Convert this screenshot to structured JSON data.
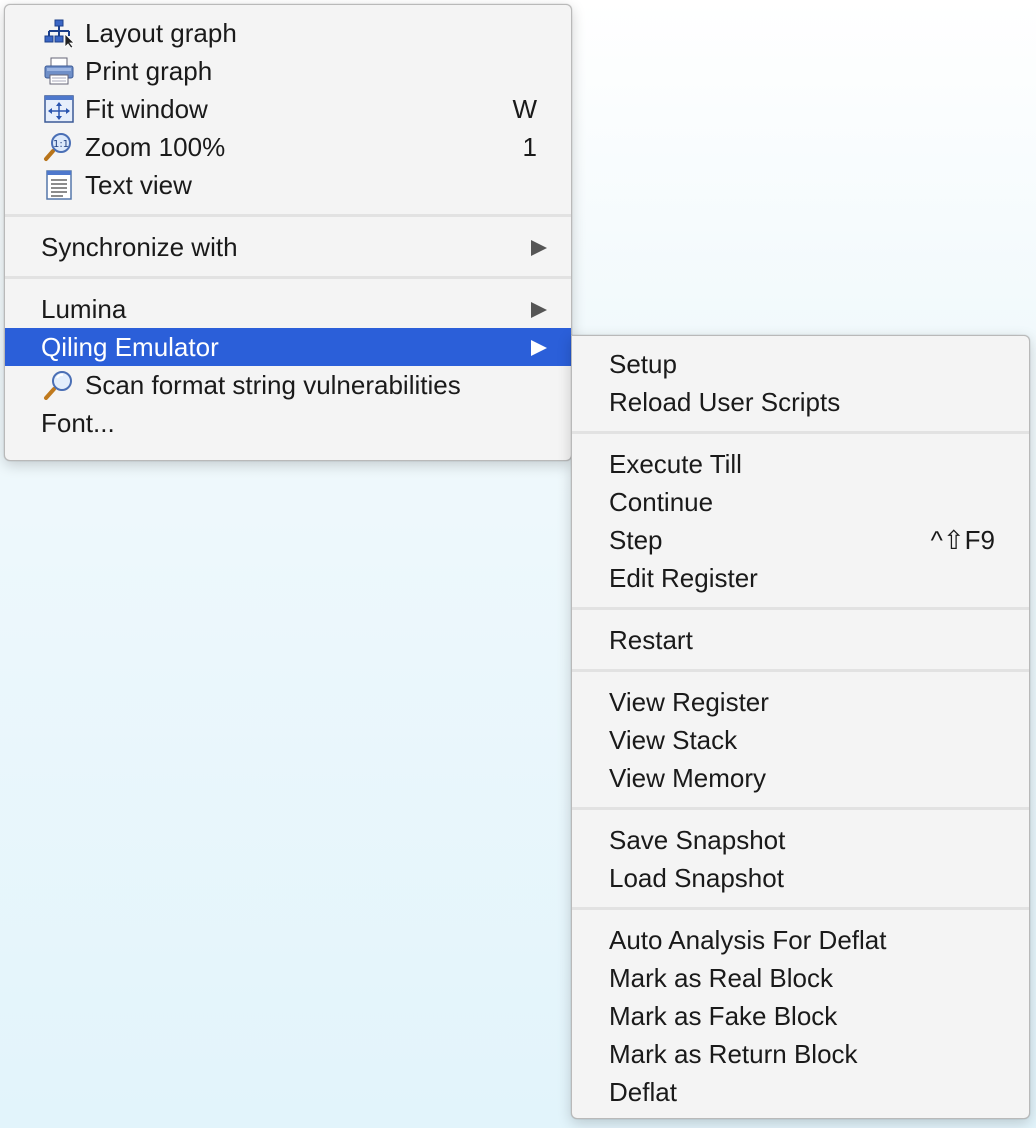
{
  "main_menu": {
    "layout_graph": {
      "label": "Layout graph",
      "icon": "layout-graph-icon"
    },
    "print_graph": {
      "label": "Print graph",
      "icon": "printer-icon"
    },
    "fit_window": {
      "label": "Fit window",
      "shortcut": "W",
      "icon": "fit-window-icon"
    },
    "zoom_100": {
      "label": "Zoom 100%",
      "shortcut": "1",
      "icon": "zoom-magnifier-icon"
    },
    "text_view": {
      "label": "Text view",
      "icon": "text-document-icon"
    },
    "synchronize_with": {
      "label": "Synchronize with"
    },
    "lumina": {
      "label": "Lumina"
    },
    "qiling_emulator": {
      "label": "Qiling Emulator"
    },
    "scan_format": {
      "label": "Scan format string vulnerabilities",
      "icon": "magnifier-icon"
    },
    "font": {
      "label": "Font..."
    }
  },
  "sub_menu": {
    "setup": "Setup",
    "reload_user_scripts": "Reload User Scripts",
    "execute_till": "Execute Till",
    "continue": "Continue",
    "step": {
      "label": "Step",
      "shortcut": "^⇧F9"
    },
    "edit_register": "Edit Register",
    "restart": "Restart",
    "view_register": "View Register",
    "view_stack": "View Stack",
    "view_memory": "View Memory",
    "save_snapshot": "Save Snapshot",
    "load_snapshot": "Load Snapshot",
    "auto_analysis": "Auto Analysis For Deflat",
    "mark_real": "Mark as Real Block",
    "mark_fake": "Mark as Fake Block",
    "mark_return": "Mark as Return Block",
    "deflat": "Deflat"
  },
  "colors": {
    "highlight": "#2b5fd9",
    "menu_bg": "#f4f4f4",
    "separator": "#e2e2e2"
  }
}
